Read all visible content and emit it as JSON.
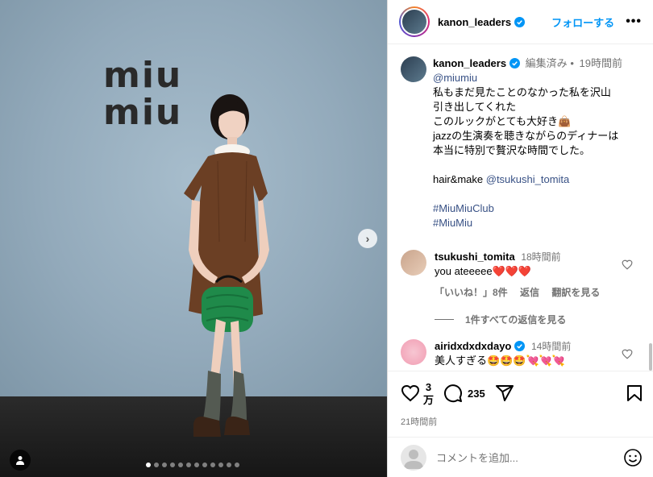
{
  "post": {
    "media": {
      "logo_line1": "miu",
      "logo_line2": "miu",
      "slide_count": 12,
      "active_slide": 1
    },
    "header": {
      "username": "kanon_leaders",
      "follow_label": "フォローする",
      "more_label": "•••"
    },
    "caption": {
      "username": "kanon_leaders",
      "edited": "編集済み",
      "separator": "•",
      "time": "19時間前",
      "mention": "@miumiu",
      "lines": [
        "私もまだ見たことのなかった私を沢山",
        "引き出してくれた",
        "このルックがとても大好き👜",
        "jazzの生演奏を聴きながらのディナーは",
        "本当に特別で贅沢な時間でした。"
      ],
      "credit_prefix": "hair&make ",
      "credit_mention": "@tsukushi_tomita",
      "hashtags": [
        "#MiuMiuClub",
        "#MiuMiu"
      ]
    },
    "comments": [
      {
        "username": "tsukushi_tomita",
        "time": "18時間前",
        "text": "you ateeeee❤️❤️❤️",
        "likes": "「いいね！」8件",
        "reply_label": "返信",
        "translate_label": "翻訳を見る",
        "view_replies": "1件すべての返信を見る"
      },
      {
        "username": "airidxdxdxdayo",
        "time": "14時間前",
        "text": "美人すぎる🤩🤩🤩💘💘💘"
      }
    ],
    "actions": {
      "like_count_line1": "3",
      "like_count_line2": "万",
      "comment_count": "235",
      "posted_time": "21時間前"
    },
    "comment_input": {
      "placeholder": "コメントを追加..."
    }
  }
}
